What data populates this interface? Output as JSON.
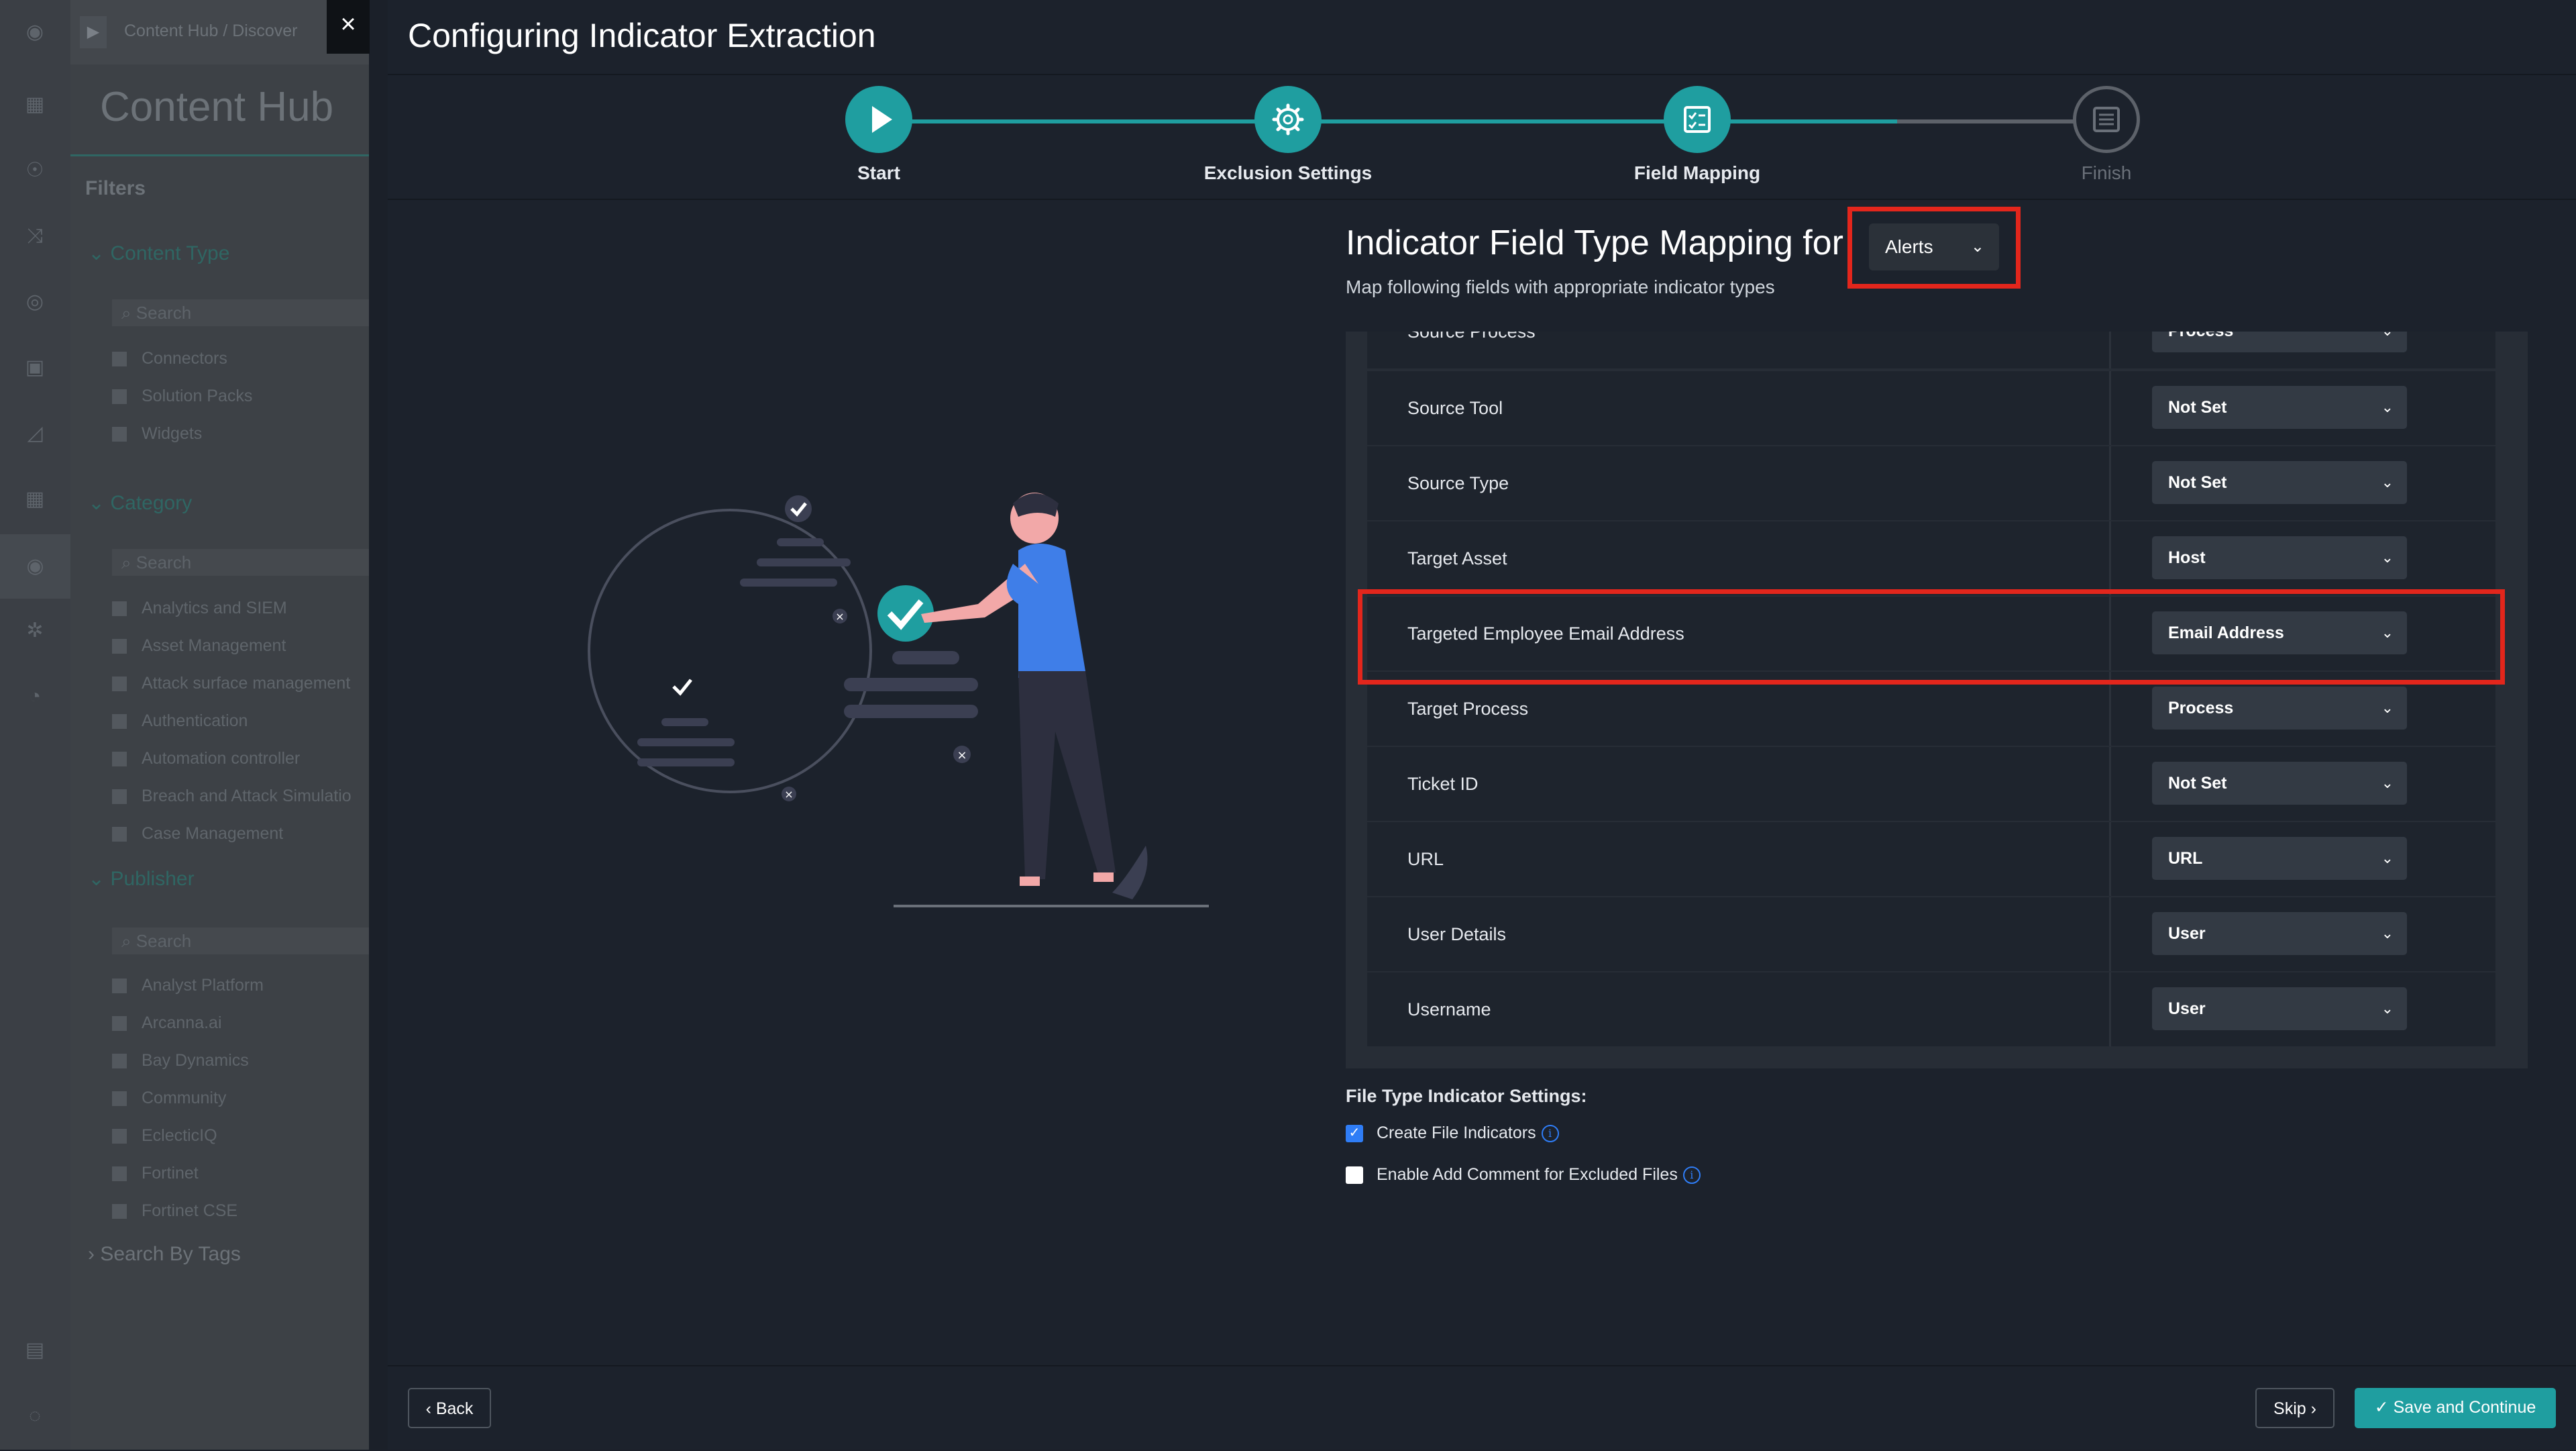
{
  "background_app": {
    "breadcrumb": "Content Hub /  Discover",
    "title": "Content Hub",
    "filters_label": "Filters",
    "content_type": {
      "label": "Content Type",
      "search_placeholder": "Search",
      "items": [
        "Connectors",
        "Solution Packs",
        "Widgets"
      ]
    },
    "category": {
      "label": "Category",
      "search_placeholder": "Search",
      "items": [
        "Analytics and SIEM",
        "Asset Management",
        "Attack surface management",
        "Authentication",
        "Automation controller",
        "Breach and Attack Simulatio",
        "Case Management"
      ]
    },
    "publisher": {
      "label": "Publisher",
      "search_placeholder": "Search",
      "items": [
        "Analyst Platform",
        "Arcanna.ai",
        "Bay Dynamics",
        "Community",
        "EclecticIQ",
        "Fortinet",
        "Fortinet CSE"
      ]
    },
    "search_by_tags": "Search By Tags"
  },
  "modal": {
    "close_icon": "close-icon",
    "title": "Configuring Indicator Extraction",
    "steps": [
      {
        "label": "Start",
        "icon": "play-icon",
        "status": "done"
      },
      {
        "label": "Exclusion Settings",
        "icon": "gear-icon",
        "status": "done"
      },
      {
        "label": "Field Mapping",
        "icon": "checklist-icon",
        "status": "done"
      },
      {
        "label": "Finish",
        "icon": "form-icon",
        "status": "todo"
      }
    ],
    "section_title": "Indicator Field Type Mapping for",
    "module_select": "Alerts",
    "section_subtitle": "Map following fields with appropriate indicator types",
    "mapping_rows": [
      {
        "field": "Source Process",
        "type": "Process"
      },
      {
        "field": "Source Tool",
        "type": "Not Set"
      },
      {
        "field": "Source Type",
        "type": "Not Set"
      },
      {
        "field": "Target Asset",
        "type": "Host"
      },
      {
        "field": "Targeted Employee Email Address",
        "type": "Email Address"
      },
      {
        "field": "Target Process",
        "type": "Process"
      },
      {
        "field": "Ticket ID",
        "type": "Not Set"
      },
      {
        "field": "URL",
        "type": "URL"
      },
      {
        "field": "User Details",
        "type": "User"
      },
      {
        "field": "Username",
        "type": "User"
      }
    ],
    "file_type_settings": {
      "title": "File Type Indicator Settings:",
      "options": [
        {
          "label": "Create File Indicators",
          "checked": true
        },
        {
          "label": "Enable Add Comment for Excluded Files",
          "checked": false
        }
      ]
    },
    "footer": {
      "back": "Back",
      "skip": "Skip",
      "save": "Save and Continue"
    }
  },
  "colors": {
    "accent": "#1f9ea0",
    "highlight": "#e3261c",
    "checkbox": "#2f7df6"
  }
}
